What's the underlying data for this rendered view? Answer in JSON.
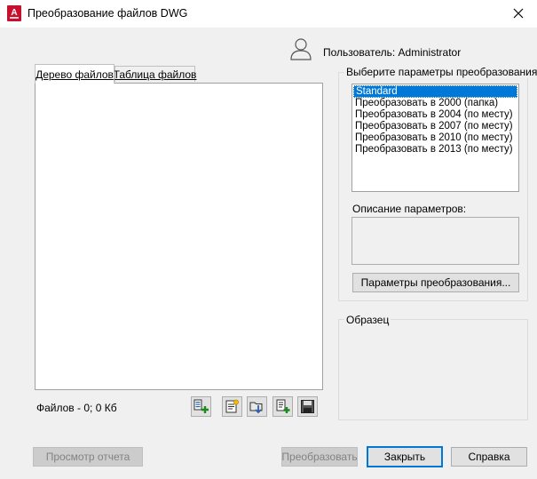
{
  "window": {
    "title": "Преобразование файлов DWG",
    "app_icon_letter": "A"
  },
  "user": {
    "label": "Пользователь: Administrator",
    "icon": "user-icon"
  },
  "tabs": [
    {
      "label": "Дерево файлов",
      "active": true
    },
    {
      "label": "Таблица файлов",
      "active": false
    }
  ],
  "files": {
    "count_text": "Файлов - 0; 0 Кб",
    "toolbar": [
      "add-file-icon",
      "notes-icon",
      "open-folder-icon",
      "append-file-icon",
      "save-icon"
    ]
  },
  "conversion_params": {
    "legend": "Выберите параметры преобразования",
    "items": [
      "Standard",
      "Преобразовать в 2000 (папка)",
      "Преобразовать в 2004 (по месту)",
      "Преобразовать в 2007 (по месту)",
      "Преобразовать в 2010 (по месту)",
      "Преобразовать в 2013 (по месту)"
    ],
    "selected_index": 0,
    "description_label": "Описание параметров:",
    "description": "",
    "params_button": "Параметры преобразования..."
  },
  "sample": {
    "legend": "Образец"
  },
  "buttons": {
    "report": "Просмотр отчета",
    "convert": "Преобразовать",
    "close": "Закрыть",
    "help": "Справка"
  },
  "colors": {
    "accent": "#0078d7",
    "autocad_red": "#c8102e"
  }
}
